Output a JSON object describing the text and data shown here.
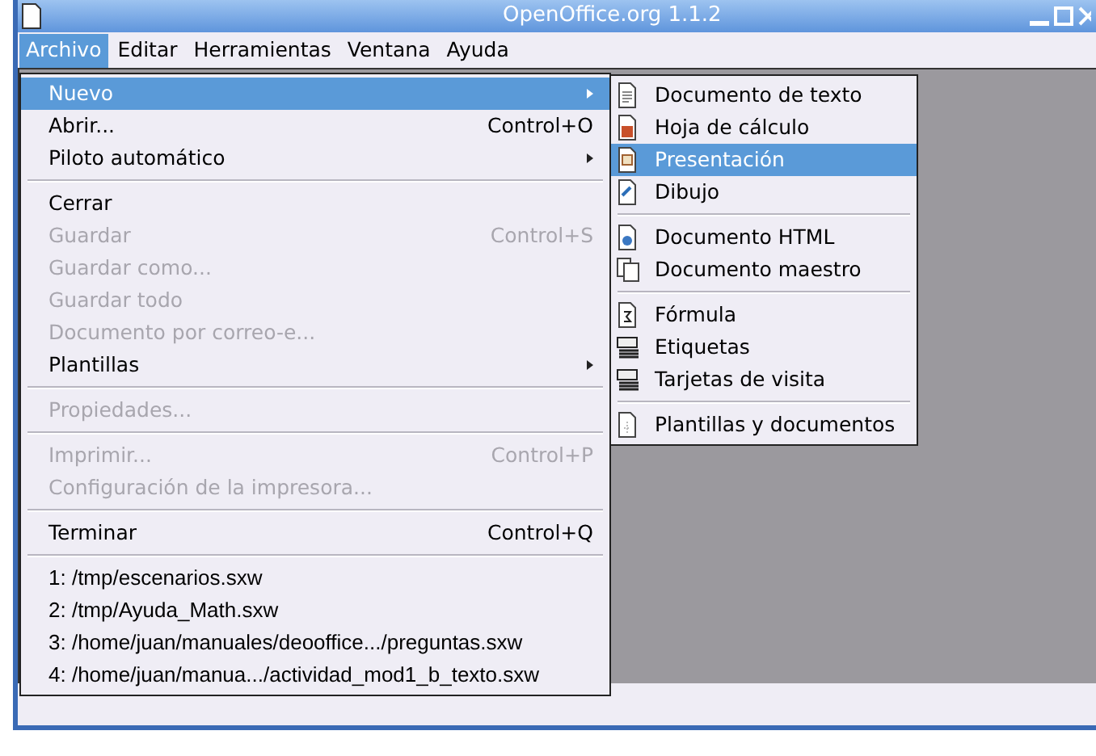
{
  "window": {
    "title": "OpenOffice.org 1.1.2"
  },
  "menubar": [
    {
      "label": "Archivo",
      "selected": true
    },
    {
      "label": "Editar",
      "selected": false
    },
    {
      "label": "Herramientas",
      "selected": false
    },
    {
      "label": "Ventana",
      "selected": false
    },
    {
      "label": "Ayuda",
      "selected": false
    }
  ],
  "file_menu": {
    "groups": [
      [
        {
          "label": "Nuevo",
          "submenu": true,
          "disabled": false,
          "selected": true
        },
        {
          "label": "Abrir...",
          "shortcut": "Control+O",
          "submenu": false,
          "disabled": false,
          "selected": false
        },
        {
          "label": "Piloto automático",
          "submenu": true,
          "disabled": false,
          "selected": false
        }
      ],
      [
        {
          "label": "Cerrar",
          "submenu": false,
          "disabled": false,
          "selected": false
        },
        {
          "label": "Guardar",
          "shortcut": "Control+S",
          "submenu": false,
          "disabled": true,
          "selected": false
        },
        {
          "label": "Guardar como...",
          "submenu": false,
          "disabled": true,
          "selected": false
        },
        {
          "label": "Guardar todo",
          "submenu": false,
          "disabled": true,
          "selected": false
        },
        {
          "label": "Documento por correo-e...",
          "submenu": false,
          "disabled": true,
          "selected": false
        },
        {
          "label": "Plantillas",
          "submenu": true,
          "disabled": false,
          "selected": false
        }
      ],
      [
        {
          "label": "Propiedades...",
          "submenu": false,
          "disabled": true,
          "selected": false
        }
      ],
      [
        {
          "label": "Imprimir...",
          "shortcut": "Control+P",
          "submenu": false,
          "disabled": true,
          "selected": false
        },
        {
          "label": "Configuración de la impresora...",
          "submenu": false,
          "disabled": true,
          "selected": false
        }
      ],
      [
        {
          "label": "Terminar",
          "shortcut": "Control+Q",
          "submenu": false,
          "disabled": false,
          "selected": false
        }
      ],
      [
        {
          "label": "1: /tmp/escenarios.sxw",
          "kind": "recent",
          "submenu": false,
          "disabled": false,
          "selected": false
        },
        {
          "label": "2: /tmp/Ayuda_Math.sxw",
          "kind": "recent",
          "submenu": false,
          "disabled": false,
          "selected": false
        },
        {
          "label": "3: /home/juan/manuales/deooffice.../preguntas.sxw",
          "kind": "recent",
          "submenu": false,
          "disabled": false,
          "selected": false
        },
        {
          "label": "4: /home/juan/manua.../actividad_mod1_b_texto.sxw",
          "kind": "recent",
          "submenu": false,
          "disabled": false,
          "selected": false
        }
      ]
    ]
  },
  "new_submenu": {
    "groups": [
      [
        {
          "label": "Documento de texto",
          "selected": false
        },
        {
          "label": "Hoja de cálculo",
          "selected": false
        },
        {
          "label": "Presentación",
          "selected": true
        },
        {
          "label": "Dibujo",
          "selected": false
        }
      ],
      [
        {
          "label": "Documento HTML",
          "selected": false
        },
        {
          "label": "Documento maestro",
          "selected": false
        }
      ],
      [
        {
          "label": "Fórmula",
          "selected": false
        },
        {
          "label": "Etiquetas",
          "selected": false
        },
        {
          "label": "Tarjetas de visita",
          "selected": false
        }
      ],
      [
        {
          "label": "Plantillas y documentos",
          "selected": false
        }
      ]
    ]
  }
}
